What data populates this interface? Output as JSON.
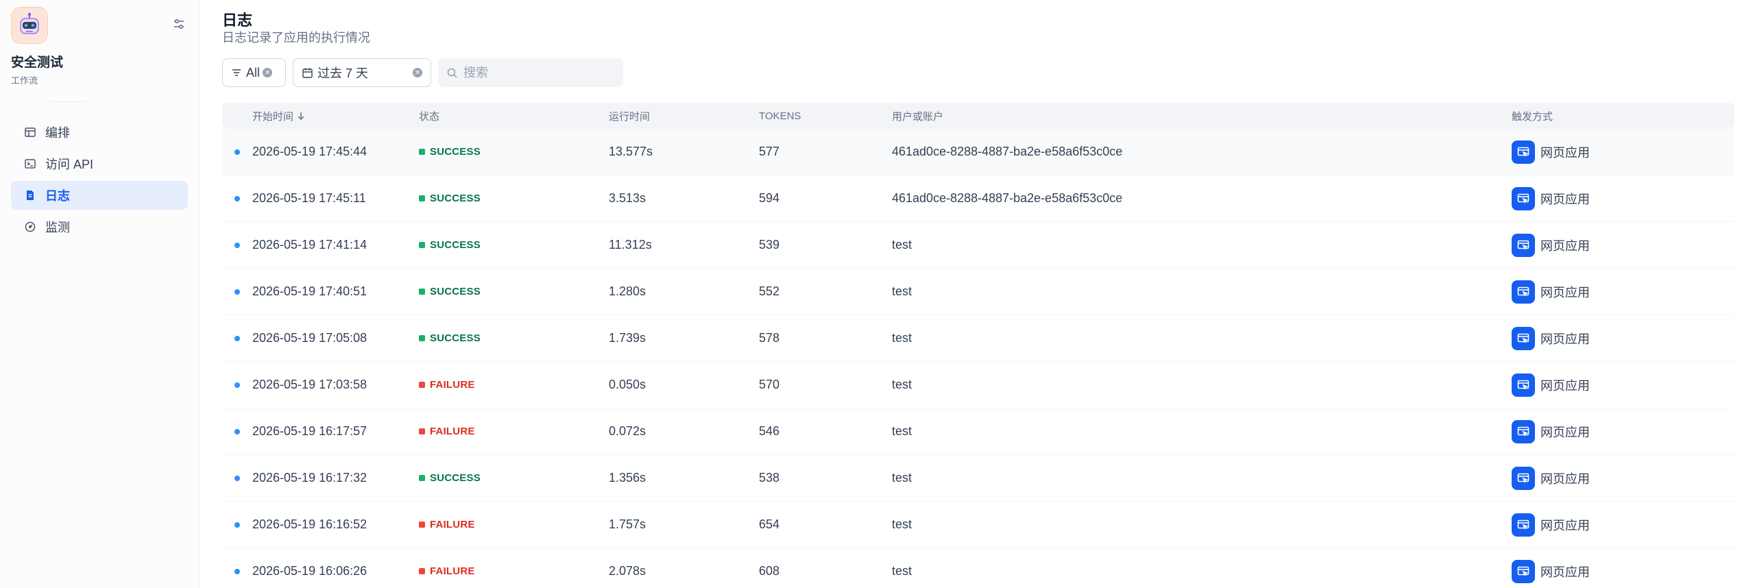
{
  "app": {
    "name": "安全测试",
    "type": "工作流"
  },
  "nav": [
    {
      "label": "编排",
      "icon": "layout-icon",
      "active": false
    },
    {
      "label": "访问 API",
      "icon": "terminal-icon",
      "active": false
    },
    {
      "label": "日志",
      "icon": "file-list-icon",
      "active": true
    },
    {
      "label": "监测",
      "icon": "dashboard-icon",
      "active": false
    }
  ],
  "page": {
    "title": "日志",
    "subtitle": "日志记录了应用的执行情况"
  },
  "filters": {
    "status": "All",
    "period": "过去 7 天",
    "search_placeholder": "搜索"
  },
  "table": {
    "headers": {
      "start_time": "开始时间",
      "status": "状态",
      "run_time": "运行时间",
      "tokens": "TOKENS",
      "user": "用户或账户",
      "trigger": "触发方式"
    },
    "rows": [
      {
        "time": "2026-05-19 17:45:44",
        "status": "SUCCESS",
        "run": "13.577s",
        "tokens": "577",
        "user": "461ad0ce-8288-4887-ba2e-e58a6f53c0ce",
        "trigger": "网页应用"
      },
      {
        "time": "2026-05-19 17:45:11",
        "status": "SUCCESS",
        "run": "3.513s",
        "tokens": "594",
        "user": "461ad0ce-8288-4887-ba2e-e58a6f53c0ce",
        "trigger": "网页应用"
      },
      {
        "time": "2026-05-19 17:41:14",
        "status": "SUCCESS",
        "run": "11.312s",
        "tokens": "539",
        "user": "test",
        "trigger": "网页应用"
      },
      {
        "time": "2026-05-19 17:40:51",
        "status": "SUCCESS",
        "run": "1.280s",
        "tokens": "552",
        "user": "test",
        "trigger": "网页应用"
      },
      {
        "time": "2026-05-19 17:05:08",
        "status": "SUCCESS",
        "run": "1.739s",
        "tokens": "578",
        "user": "test",
        "trigger": "网页应用"
      },
      {
        "time": "2026-05-19 17:03:58",
        "status": "FAILURE",
        "run": "0.050s",
        "tokens": "570",
        "user": "test",
        "trigger": "网页应用"
      },
      {
        "time": "2026-05-19 16:17:57",
        "status": "FAILURE",
        "run": "0.072s",
        "tokens": "546",
        "user": "test",
        "trigger": "网页应用"
      },
      {
        "time": "2026-05-19 16:17:32",
        "status": "SUCCESS",
        "run": "1.356s",
        "tokens": "538",
        "user": "test",
        "trigger": "网页应用"
      },
      {
        "time": "2026-05-19 16:16:52",
        "status": "FAILURE",
        "run": "1.757s",
        "tokens": "654",
        "user": "test",
        "trigger": "网页应用"
      },
      {
        "time": "2026-05-19 16:06:26",
        "status": "FAILURE",
        "run": "2.078s",
        "tokens": "608",
        "user": "test",
        "trigger": "网页应用"
      }
    ]
  },
  "colors": {
    "accent": "#155eef",
    "success": "#17b26a",
    "failure": "#f04438"
  }
}
